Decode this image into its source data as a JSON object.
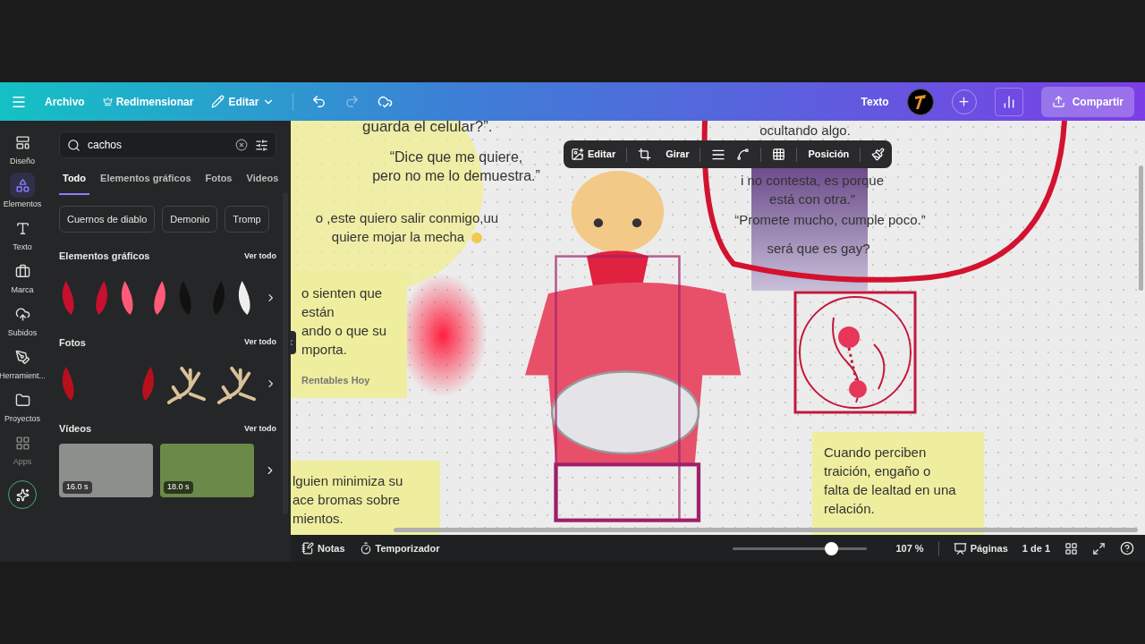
{
  "topbar": {
    "file": "Archivo",
    "resize": "Redimensionar",
    "edit": "Editar",
    "mode": "Texto",
    "share": "Compartir"
  },
  "rail": [
    {
      "label": "Diseño",
      "kind": "layout",
      "selected": false,
      "disabled": false
    },
    {
      "label": "Elementos",
      "kind": "elements",
      "selected": true,
      "disabled": false
    },
    {
      "label": "Texto",
      "kind": "text",
      "selected": false,
      "disabled": false
    },
    {
      "label": "Marca",
      "kind": "brand",
      "selected": false,
      "disabled": false
    },
    {
      "label": "Subidos",
      "kind": "upload",
      "selected": false,
      "disabled": false
    },
    {
      "label": "Herramient...",
      "kind": "tools",
      "selected": false,
      "disabled": false
    },
    {
      "label": "Proyectos",
      "kind": "folder",
      "selected": false,
      "disabled": false
    },
    {
      "label": "Apps",
      "kind": "apps",
      "selected": false,
      "disabled": true
    }
  ],
  "panel": {
    "search": {
      "value": "cachos"
    },
    "tabs": [
      {
        "label": "Todo",
        "selected": true
      },
      {
        "label": "Elementos gráficos",
        "selected": false
      },
      {
        "label": "Fotos",
        "selected": false
      },
      {
        "label": "Videos",
        "selected": false
      }
    ],
    "chips": [
      "Cuernos de diablo",
      "Demonio",
      "Tromp"
    ],
    "sections": [
      {
        "title": "Elementos gráficos",
        "link": "Ver todo",
        "kind": "graphics"
      },
      {
        "title": "Fotos",
        "link": "Ver todo",
        "kind": "photos"
      },
      {
        "title": "Vídeos",
        "link": "Ver todo",
        "kind": "videos",
        "durations": [
          "16.0 s",
          "18.0 s"
        ]
      }
    ]
  },
  "canvas": {
    "toolbar": [
      "Editar",
      "Girar",
      "Posición"
    ],
    "texts": [
      {
        "kind": "plain",
        "lines": [
          "guarda el celular?”."
        ]
      },
      {
        "kind": "plain",
        "lines": [
          "“Dice que me quiere,",
          "pero no me lo demuestra.”"
        ]
      },
      {
        "kind": "plain",
        "lines": [
          "o ,este quiero salir conmigo,uu",
          "quiere mojar la mecha"
        ]
      },
      {
        "kind": "plain",
        "lines": [
          "ocultando algo."
        ]
      },
      {
        "kind": "plain",
        "lines": [
          "i no contesta, es porque",
          "está con otra.”"
        ]
      },
      {
        "kind": "plain",
        "lines": [
          "“Promete mucho, cumple poco.”"
        ]
      },
      {
        "kind": "plain",
        "lines": [
          "será que es gay?"
        ]
      },
      {
        "kind": "note",
        "lines": [
          "o sienten que",
          "están",
          "ando o que su",
          "mporta."
        ],
        "footer": "Rentables Hoy"
      },
      {
        "kind": "note",
        "lines": [
          "lguien minimiza su",
          "ace bromas sobre",
          "mientos."
        ]
      },
      {
        "kind": "note",
        "lines": [
          "Cuando perciben",
          "traición, engaño o",
          "falta de lealtad en una",
          "relación."
        ]
      }
    ]
  },
  "bottombar": {
    "notes": "Notas",
    "timer": "Temporizador",
    "zoom": {
      "level": 0.73,
      "reading": "107 %"
    },
    "pages": "Páginas",
    "page_count": "1 de 1"
  }
}
